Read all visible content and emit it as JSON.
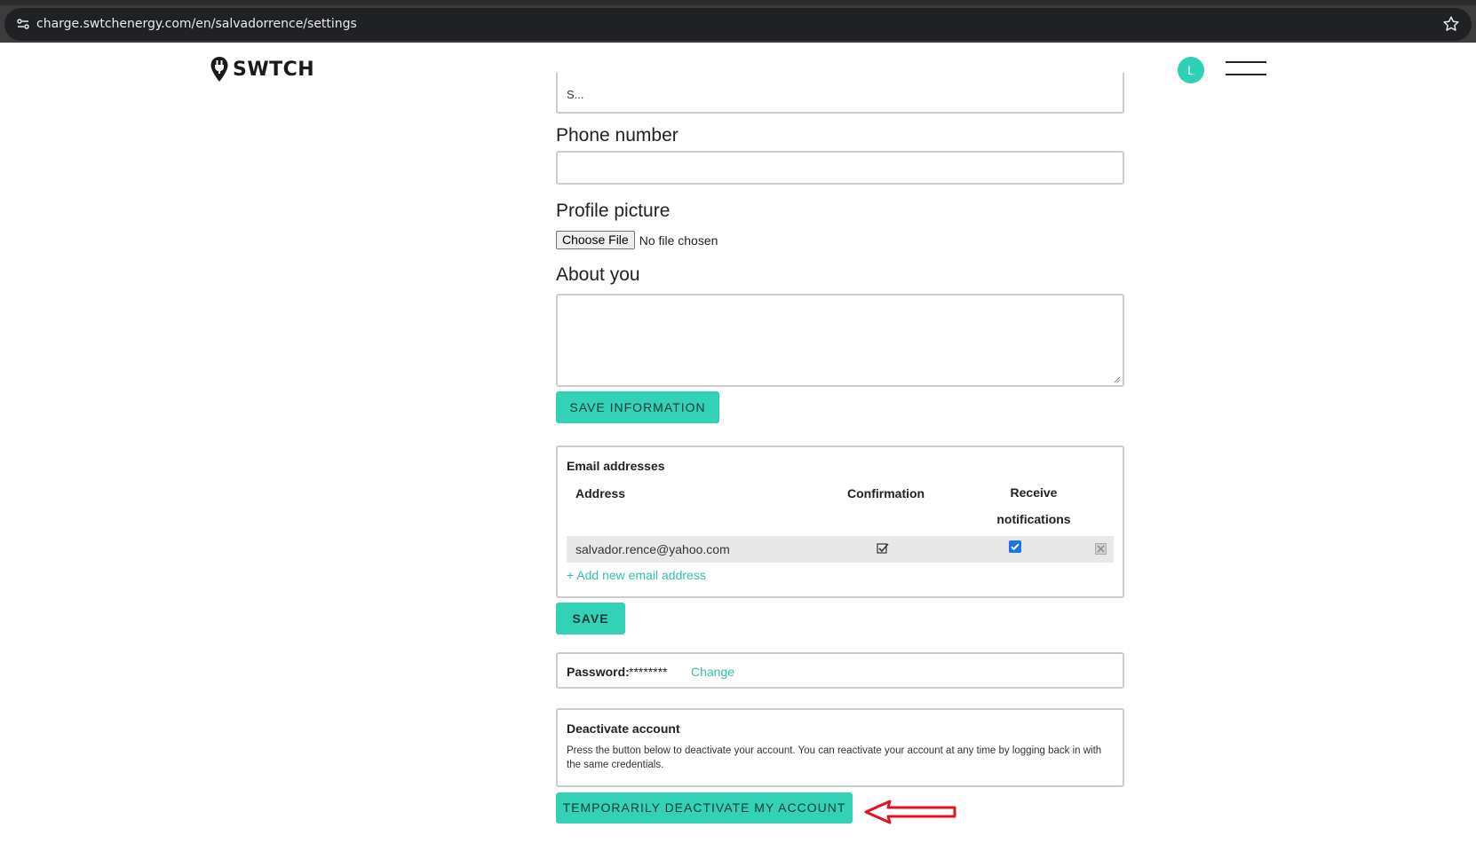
{
  "browser": {
    "url": "charge.swtchenergy.com/en/salvadorrence/settings"
  },
  "header": {
    "logo_text": "SWTCH",
    "avatar_initial": "L"
  },
  "form": {
    "top_field_value": "S...",
    "phone_label": "Phone number",
    "phone_value": "",
    "profile_picture_label": "Profile picture",
    "choose_file_label": "Choose File",
    "file_status": "No file chosen",
    "about_label": "About you",
    "about_value": "",
    "save_information_label": "SAVE INFORMATION"
  },
  "emails": {
    "title": "Email addresses",
    "col_address": "Address",
    "col_confirmation": "Confirmation",
    "col_receive": "Receive notifications",
    "rows": [
      {
        "address": "salvador.rence@yahoo.com",
        "confirmed": true,
        "receive_notifications": true
      }
    ],
    "add_link": "+ Add new email address",
    "save_label": "SAVE"
  },
  "password": {
    "label": "Password:",
    "value": "********",
    "change_link": "Change"
  },
  "deactivate": {
    "title": "Deactivate account",
    "text": "Press the button below to deactivate your account. You can reactivate your account at any time by logging back in with the same credentials.",
    "button_label": "TEMPORARILY DEACTIVATE MY ACCOUNT"
  },
  "colors": {
    "accent": "#33d1b5",
    "link": "#2ec4a9",
    "annotation_arrow": "#e0141e"
  }
}
